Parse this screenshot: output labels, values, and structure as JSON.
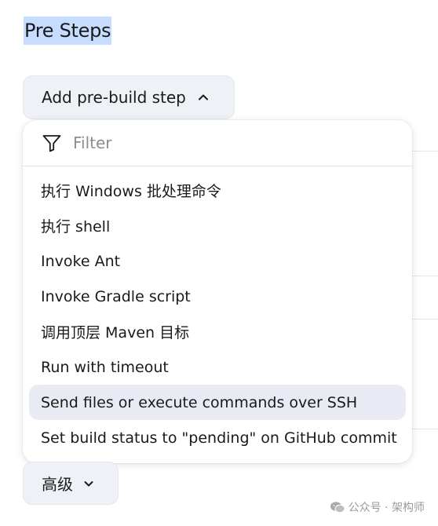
{
  "section": {
    "title": "Pre Steps"
  },
  "add_step_button": {
    "label": "Add pre-build step",
    "icon": "chevron-up-icon"
  },
  "dropdown": {
    "filter": {
      "icon": "filter-icon",
      "placeholder": "Filter",
      "value": ""
    },
    "items": [
      {
        "label": "执行 Windows 批处理命令",
        "highlighted": false
      },
      {
        "label": "执行 shell",
        "highlighted": false
      },
      {
        "label": "Invoke Ant",
        "highlighted": false
      },
      {
        "label": "Invoke Gradle script",
        "highlighted": false
      },
      {
        "label": "调用顶层 Maven 目标",
        "highlighted": false
      },
      {
        "label": "Run with timeout",
        "highlighted": false
      },
      {
        "label": "Send files or execute commands over SSH",
        "highlighted": true
      },
      {
        "label": "Set build status to \"pending\" on GitHub commit",
        "highlighted": false
      }
    ]
  },
  "advanced_button": {
    "label": "高级",
    "icon": "chevron-down-icon"
  },
  "watermark": {
    "text": "公众号 · 架构师",
    "icon": "wechat-icon"
  },
  "colors": {
    "title_highlight": "#c7ddff",
    "button_bg": "#eef1f6",
    "item_highlight": "#e8ebf3",
    "divider": "#e1e3e7"
  }
}
